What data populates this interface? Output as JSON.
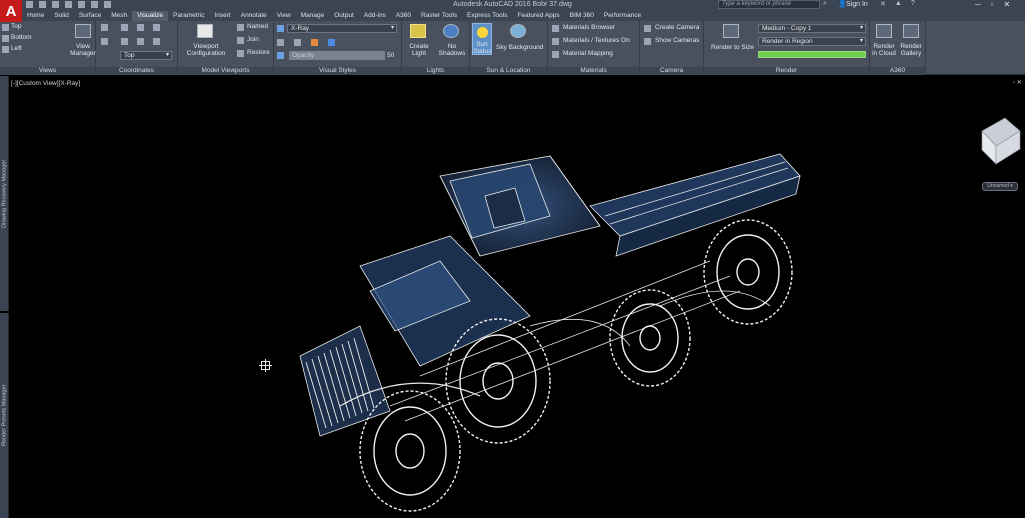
{
  "titlebar": {
    "app_logo": "A",
    "title": "Autodesk AutoCAD 2016    Bobr 37.dwg",
    "search_placeholder": "Type a keyword or phrase",
    "sign_in": "Sign In"
  },
  "tabs": [
    "Home",
    "Solid",
    "Surface",
    "Mesh",
    "Visualize",
    "Parametric",
    "Insert",
    "Annotate",
    "View",
    "Manage",
    "Output",
    "Add-ins",
    "A360",
    "Raster Tools",
    "Express Tools",
    "Featured Apps",
    "BIM 360",
    "Performance"
  ],
  "active_tab": "Visualize",
  "ribbon": {
    "views": {
      "title": "Views",
      "items": [
        "Top",
        "Bottom",
        "Left"
      ],
      "manager": "View Manager"
    },
    "coordinates": {
      "title": "Coordinates",
      "ucs_value": "Top"
    },
    "model_viewports": {
      "title": "Model Viewports",
      "config": "Viewport Configuration",
      "named": "Named",
      "join": "Join",
      "restore": "Restore"
    },
    "visual_styles": {
      "title": "Visual Styles",
      "style": "X-Ray",
      "opacity_label": "Opacity",
      "opacity_value": "50"
    },
    "lights": {
      "title": "Lights",
      "create_light": "Create Light",
      "no_shadows": "No Shadows"
    },
    "sun_location": {
      "title": "Sun & Location",
      "sun_status": "Sun Status",
      "sky": "Sky Background"
    },
    "materials": {
      "title": "Materials",
      "browser": "Materials Browser",
      "textures": "Materials / Textures On",
      "mapping": "Material Mapping"
    },
    "camera": {
      "title": "Camera",
      "create": "Create Camera",
      "show": "Show Cameras"
    },
    "render": {
      "title": "Render",
      "render_to_size": "Render to Size",
      "preset": "Medium - Copy 1",
      "region": "Render in Region",
      "progress_fraction": 1.0
    },
    "a360": {
      "title": "A360",
      "render_in_cloud": "Render in Cloud",
      "render_gallery": "Render Gallery"
    }
  },
  "side_palettes": {
    "top": "Drawing Recovery Manager",
    "bottom": "Render Presets Manager"
  },
  "viewport": {
    "label": "[-][Custom View][X-Ray]",
    "close": "▫ ✕",
    "wcs": "Unnamed ▾"
  },
  "colors": {
    "accent_blue": "#5d8fc9",
    "sun": "#ffd43a",
    "progress_green": "#6fcd4d",
    "logo_red": "#c41a1a"
  },
  "icons": [
    "app-logo-icon",
    "search-icon",
    "user-icon",
    "help-icon",
    "minimize-icon",
    "maximize-icon",
    "close-icon",
    "viewcube-icon",
    "crosshair-cursor-icon"
  ]
}
